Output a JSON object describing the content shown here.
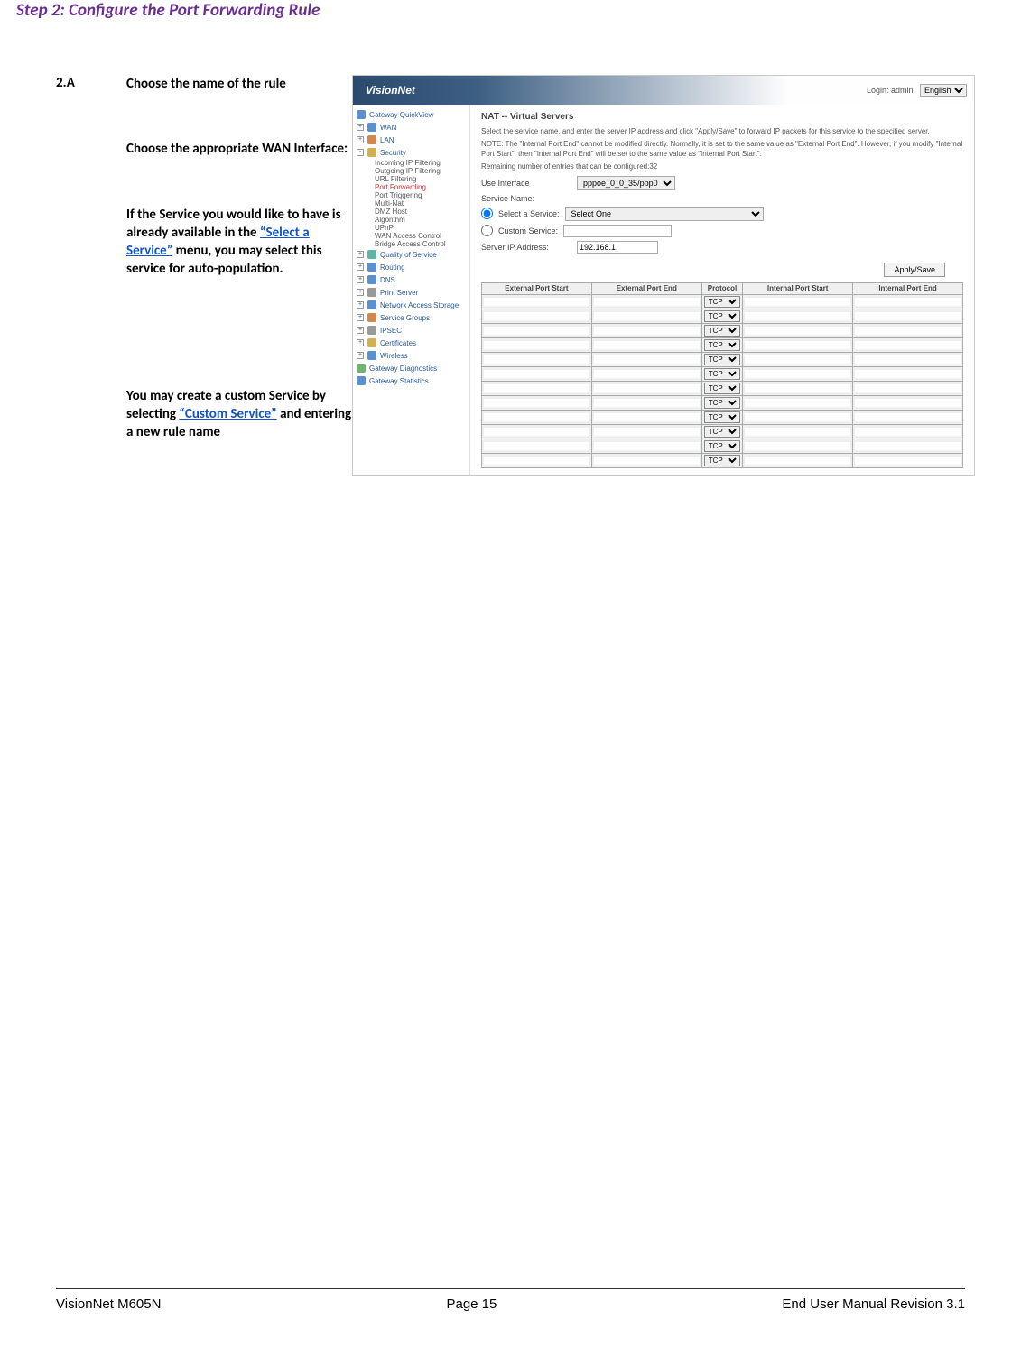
{
  "page": {
    "step_title": "Step 2: Configure the Port Forwarding Rule",
    "step_num": "2.A",
    "instruction_bold": "Choose the name of the rule",
    "wan_label_prefix": "Choose the appropriate WAN Interface:",
    "service_text_1": "If the Service you would like to have is already available in the ",
    "service_link_1": "“Select a Service”",
    "service_text_2": " menu, you may select this service for auto-population.",
    "custom_text_1": "You may create a custom Service by selecting ",
    "custom_link": "“Custom Service”",
    "custom_text_2": " and entering a new rule name"
  },
  "router": {
    "brand": "VisionNet",
    "login_label": "Login: admin",
    "lang_selected": "English",
    "sidebar": {
      "quickview": "Gateway QuickView",
      "wan": "WAN",
      "lan": "LAN",
      "security": "Security",
      "sec_items": [
        "Incoming IP Filtering",
        "Outgoing IP Filtering",
        "URL Filtering",
        "Port Forwarding",
        "Port Triggering",
        "Multi-Nat",
        "DMZ Host",
        "Algorithm",
        "UPnP",
        "WAN Access Control",
        "Bridge Access Control"
      ],
      "qos": "Quality of Service",
      "routing": "Routing",
      "dns": "DNS",
      "print": "Print Server",
      "nas": "Network Access Storage",
      "groups": "Service Groups",
      "ipsec": "IPSEC",
      "certs": "Certificates",
      "wireless": "Wireless",
      "diag": "Gateway Diagnostics",
      "stats": "Gateway Statistics"
    },
    "main": {
      "title": "NAT -- Virtual Servers",
      "desc1": "Select the service name, and enter the server IP address and click \"Apply/Save\" to forward IP packets for this service to the specified server.",
      "desc2": "NOTE: The \"Internal Port End\" cannot be modified directly. Normally, it is set to the same value as \"External Port End\". However, if you modify \"Internal Port Start\", then \"Internal Port End\" will be set to the same value as \"Internal Port Start\".",
      "remaining": "Remaining number of entries that can be configured:32",
      "use_interface_label": "Use Interface",
      "use_interface_value": "pppoe_0_0_35/ppp0",
      "service_name_label": "Service Name:",
      "select_service_label": "Select a Service:",
      "select_service_value": "Select One",
      "custom_service_label": "Custom Service:",
      "server_ip_label": "Server IP Address:",
      "server_ip_value": "192.168.1.",
      "apply_button": "Apply/Save",
      "table_headers": [
        "External Port Start",
        "External Port End",
        "Protocol",
        "Internal Port Start",
        "Internal Port End"
      ],
      "proto_default": "TCP"
    }
  },
  "footer": {
    "left": "VisionNet M605N",
    "center": "Page 15",
    "right": "End User Manual Revision 3.1"
  }
}
